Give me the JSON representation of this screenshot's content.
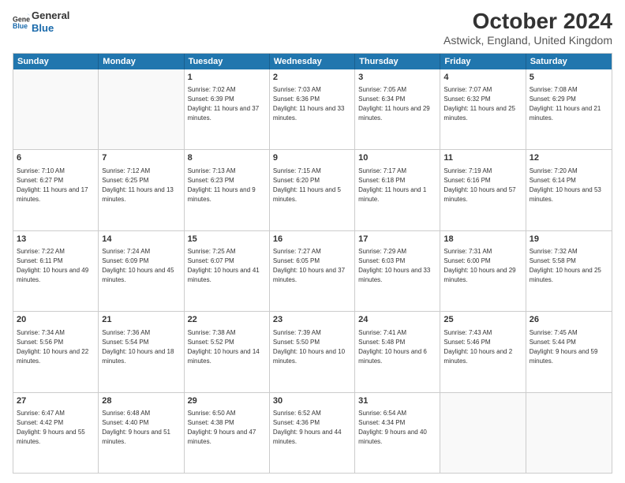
{
  "header": {
    "logo_line1": "General",
    "logo_line2": "Blue",
    "month_title": "October 2024",
    "location": "Astwick, England, United Kingdom"
  },
  "calendar": {
    "days_of_week": [
      "Sunday",
      "Monday",
      "Tuesday",
      "Wednesday",
      "Thursday",
      "Friday",
      "Saturday"
    ],
    "rows": [
      [
        {
          "day": "",
          "info": ""
        },
        {
          "day": "",
          "info": ""
        },
        {
          "day": "1",
          "info": "Sunrise: 7:02 AM\nSunset: 6:39 PM\nDaylight: 11 hours and 37 minutes."
        },
        {
          "day": "2",
          "info": "Sunrise: 7:03 AM\nSunset: 6:36 PM\nDaylight: 11 hours and 33 minutes."
        },
        {
          "day": "3",
          "info": "Sunrise: 7:05 AM\nSunset: 6:34 PM\nDaylight: 11 hours and 29 minutes."
        },
        {
          "day": "4",
          "info": "Sunrise: 7:07 AM\nSunset: 6:32 PM\nDaylight: 11 hours and 25 minutes."
        },
        {
          "day": "5",
          "info": "Sunrise: 7:08 AM\nSunset: 6:29 PM\nDaylight: 11 hours and 21 minutes."
        }
      ],
      [
        {
          "day": "6",
          "info": "Sunrise: 7:10 AM\nSunset: 6:27 PM\nDaylight: 11 hours and 17 minutes."
        },
        {
          "day": "7",
          "info": "Sunrise: 7:12 AM\nSunset: 6:25 PM\nDaylight: 11 hours and 13 minutes."
        },
        {
          "day": "8",
          "info": "Sunrise: 7:13 AM\nSunset: 6:23 PM\nDaylight: 11 hours and 9 minutes."
        },
        {
          "day": "9",
          "info": "Sunrise: 7:15 AM\nSunset: 6:20 PM\nDaylight: 11 hours and 5 minutes."
        },
        {
          "day": "10",
          "info": "Sunrise: 7:17 AM\nSunset: 6:18 PM\nDaylight: 11 hours and 1 minute."
        },
        {
          "day": "11",
          "info": "Sunrise: 7:19 AM\nSunset: 6:16 PM\nDaylight: 10 hours and 57 minutes."
        },
        {
          "day": "12",
          "info": "Sunrise: 7:20 AM\nSunset: 6:14 PM\nDaylight: 10 hours and 53 minutes."
        }
      ],
      [
        {
          "day": "13",
          "info": "Sunrise: 7:22 AM\nSunset: 6:11 PM\nDaylight: 10 hours and 49 minutes."
        },
        {
          "day": "14",
          "info": "Sunrise: 7:24 AM\nSunset: 6:09 PM\nDaylight: 10 hours and 45 minutes."
        },
        {
          "day": "15",
          "info": "Sunrise: 7:25 AM\nSunset: 6:07 PM\nDaylight: 10 hours and 41 minutes."
        },
        {
          "day": "16",
          "info": "Sunrise: 7:27 AM\nSunset: 6:05 PM\nDaylight: 10 hours and 37 minutes."
        },
        {
          "day": "17",
          "info": "Sunrise: 7:29 AM\nSunset: 6:03 PM\nDaylight: 10 hours and 33 minutes."
        },
        {
          "day": "18",
          "info": "Sunrise: 7:31 AM\nSunset: 6:00 PM\nDaylight: 10 hours and 29 minutes."
        },
        {
          "day": "19",
          "info": "Sunrise: 7:32 AM\nSunset: 5:58 PM\nDaylight: 10 hours and 25 minutes."
        }
      ],
      [
        {
          "day": "20",
          "info": "Sunrise: 7:34 AM\nSunset: 5:56 PM\nDaylight: 10 hours and 22 minutes."
        },
        {
          "day": "21",
          "info": "Sunrise: 7:36 AM\nSunset: 5:54 PM\nDaylight: 10 hours and 18 minutes."
        },
        {
          "day": "22",
          "info": "Sunrise: 7:38 AM\nSunset: 5:52 PM\nDaylight: 10 hours and 14 minutes."
        },
        {
          "day": "23",
          "info": "Sunrise: 7:39 AM\nSunset: 5:50 PM\nDaylight: 10 hours and 10 minutes."
        },
        {
          "day": "24",
          "info": "Sunrise: 7:41 AM\nSunset: 5:48 PM\nDaylight: 10 hours and 6 minutes."
        },
        {
          "day": "25",
          "info": "Sunrise: 7:43 AM\nSunset: 5:46 PM\nDaylight: 10 hours and 2 minutes."
        },
        {
          "day": "26",
          "info": "Sunrise: 7:45 AM\nSunset: 5:44 PM\nDaylight: 9 hours and 59 minutes."
        }
      ],
      [
        {
          "day": "27",
          "info": "Sunrise: 6:47 AM\nSunset: 4:42 PM\nDaylight: 9 hours and 55 minutes."
        },
        {
          "day": "28",
          "info": "Sunrise: 6:48 AM\nSunset: 4:40 PM\nDaylight: 9 hours and 51 minutes."
        },
        {
          "day": "29",
          "info": "Sunrise: 6:50 AM\nSunset: 4:38 PM\nDaylight: 9 hours and 47 minutes."
        },
        {
          "day": "30",
          "info": "Sunrise: 6:52 AM\nSunset: 4:36 PM\nDaylight: 9 hours and 44 minutes."
        },
        {
          "day": "31",
          "info": "Sunrise: 6:54 AM\nSunset: 4:34 PM\nDaylight: 9 hours and 40 minutes."
        },
        {
          "day": "",
          "info": ""
        },
        {
          "day": "",
          "info": ""
        }
      ]
    ]
  }
}
